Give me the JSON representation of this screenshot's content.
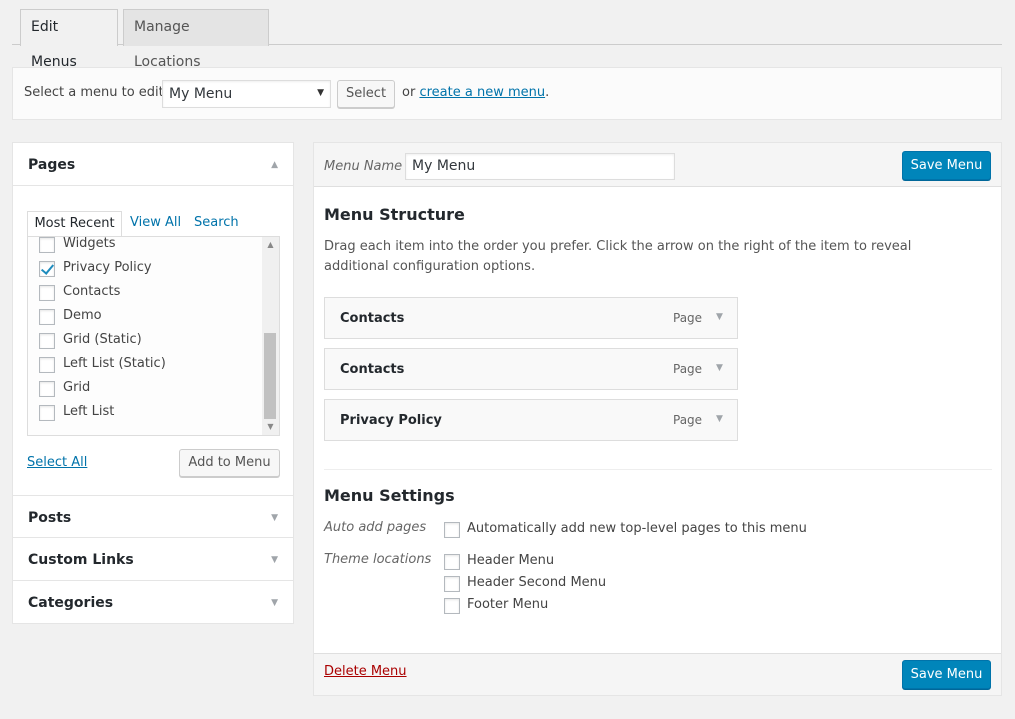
{
  "tabs": {
    "edit": "Edit Menus",
    "manage": "Manage Locations"
  },
  "select_bar": {
    "label": "Select a menu to edit:",
    "selected": "My Menu",
    "select_button": "Select",
    "or_text": "or",
    "create_link": "create a new menu",
    "period": "."
  },
  "sidebar": {
    "pages_title": "Pages",
    "tabs": {
      "most_recent": "Most Recent",
      "view_all": "View All",
      "search": "Search"
    },
    "items": [
      {
        "label": "Widgets",
        "checked": false
      },
      {
        "label": "Privacy Policy",
        "checked": true
      },
      {
        "label": "Contacts",
        "checked": false
      },
      {
        "label": "Demo",
        "checked": false
      },
      {
        "label": "Grid (Static)",
        "checked": false
      },
      {
        "label": "Left List (Static)",
        "checked": false
      },
      {
        "label": "Grid",
        "checked": false
      },
      {
        "label": "Left List",
        "checked": false
      }
    ],
    "select_all": "Select All",
    "add_button": "Add to Menu",
    "sections": {
      "posts": "Posts",
      "custom_links": "Custom Links",
      "categories": "Categories"
    }
  },
  "editor": {
    "menu_name_label": "Menu Name",
    "menu_name_value": "My Menu",
    "save_label": "Save Menu",
    "structure_title": "Menu Structure",
    "structure_desc": "Drag each item into the order you prefer. Click the arrow on the right of the item to reveal additional configuration options.",
    "items": [
      {
        "title": "Contacts",
        "type": "Page"
      },
      {
        "title": "Contacts",
        "type": "Page"
      },
      {
        "title": "Privacy Policy",
        "type": "Page"
      }
    ],
    "settings_title": "Menu Settings",
    "auto_add_label": "Auto add pages",
    "auto_add_option": "Automatically add new top-level pages to this menu",
    "theme_locations_label": "Theme locations",
    "locations": [
      "Header Menu",
      "Header Second Menu",
      "Footer Menu"
    ],
    "delete_label": "Delete Menu"
  },
  "colors": {
    "primary": "#0085ba",
    "link": "#0073aa",
    "delete": "#a00000"
  }
}
